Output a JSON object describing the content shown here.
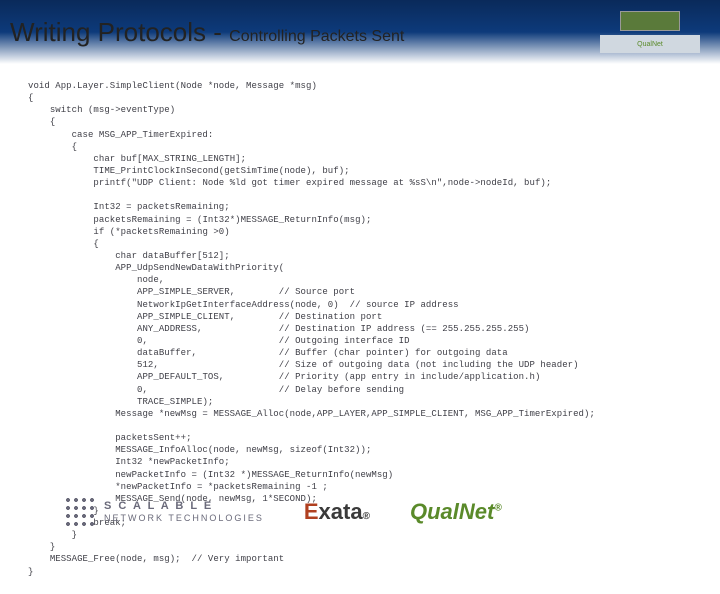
{
  "header": {
    "title_main": "Writing Protocols - ",
    "title_sub": "Controlling Packets Sent",
    "thumb_label": "QualNet"
  },
  "code": "void App.Layer.SimpleClient(Node *node, Message *msg)\n{\n    switch (msg->eventType)\n    {\n        case MSG_APP_TimerExpired:\n        {\n            char buf[MAX_STRING_LENGTH];\n            TIME_PrintClockInSecond(getSimTime(node), buf);\n            printf(\"UDP Client: Node %ld got timer expired message at %sS\\n\",node->nodeId, buf);\n\n            Int32 = packetsRemaining;\n            packetsRemaining = (Int32*)MESSAGE_ReturnInfo(msg);\n            if (*packetsRemaining >0)\n            {\n                char dataBuffer[512];\n                APP_UdpSendNewDataWithPriority(\n                    node,\n                    APP_SIMPLE_SERVER,        // Source port\n                    NetworkIpGetInterfaceAddress(node, 0)  // source IP address\n                    APP_SIMPLE_CLIENT,        // Destination port\n                    ANY_ADDRESS,              // Destination IP address (== 255.255.255.255)\n                    0,                        // Outgoing interface ID\n                    dataBuffer,               // Buffer (char pointer) for outgoing data\n                    512,                      // Size of outgoing data (not including the UDP header)\n                    APP_DEFAULT_TOS,          // Priority (app entry in include/application.h)\n                    0,                        // Delay before sending\n                    TRACE_SIMPLE);\n                Message *newMsg = MESSAGE_Alloc(node,APP_LAYER,APP_SIMPLE_CLIENT, MSG_APP_TimerExpired);\n\n                packetsSent++;\n                MESSAGE_InfoAlloc(node, newMsg, sizeof(Int32));\n                Int32 *newPacketInfo;\n                newPacketInfo = (Int32 *)MESSAGE_ReturnInfo(newMsg)\n                *newPacketInfo = *packetsRemaining -1 ;\n                MESSAGE_Send(node, newMsg, 1*SECOND);\n            }\n            break;\n        }\n    }\n    MESSAGE_Free(node, msg);  // Very important\n}",
  "footer": {
    "scalable_l1": "S C A L A B L E",
    "scalable_l2": "NETWORK TECHNOLOGIES",
    "exata_e": "E",
    "exata_rest": "xata",
    "exata_tm": "®",
    "qualnet": "QualNet",
    "qualnet_tm": "®"
  }
}
